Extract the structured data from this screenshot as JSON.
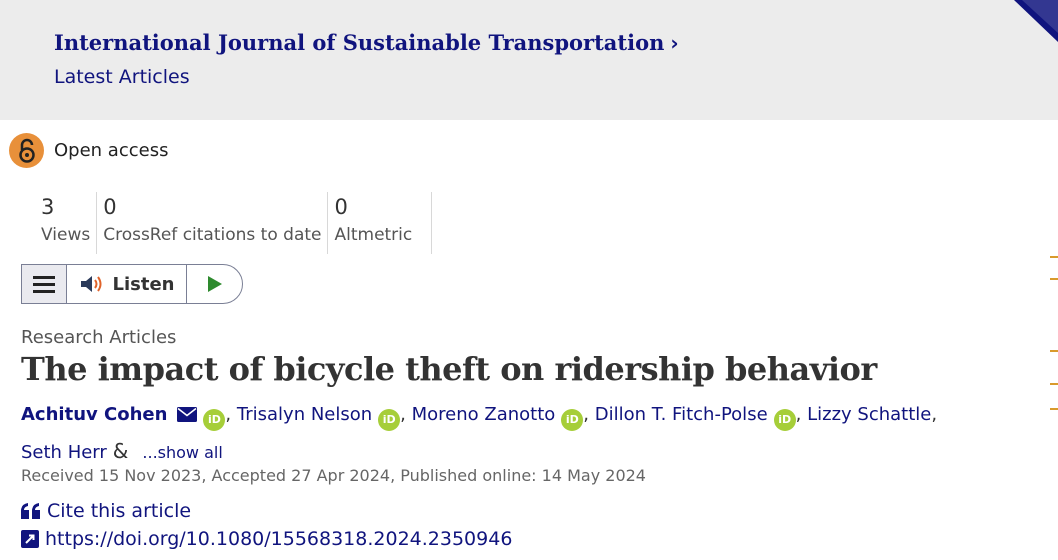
{
  "header": {
    "journal_title": "International Journal of Sustainable Transportation",
    "journal_chevron": "›",
    "latest_articles": "Latest Articles"
  },
  "access": {
    "label": "Open access"
  },
  "metrics": [
    {
      "value": "3",
      "label": "Views"
    },
    {
      "value": "0",
      "label": "CrossRef citations to date"
    },
    {
      "value": "0",
      "label": "Altmetric"
    }
  ],
  "toolbar": {
    "listen_label": "Listen"
  },
  "article": {
    "type": "Research Articles",
    "title": "The impact of bicycle theft on ridership behavior",
    "authors": [
      "Achituv Cohen",
      "Trisalyn Nelson",
      "Moreno Zanotto",
      "Dillon T. Fitch-Polse",
      "Lizzy Schattle",
      "Seth Herr"
    ],
    "orcid_label": "iD",
    "ampersand": "&",
    "show_all": "...show all",
    "dates": "Received 15 Nov 2023, Accepted 27 Apr 2024, Published online: 14 May 2024",
    "cite_label": "Cite this article",
    "doi": "https://doi.org/10.1080/15568318.2024.2350946"
  },
  "colors": {
    "link_navy": "#10147e",
    "open_access_orange": "#e8903a",
    "orcid_green": "#a6ce39",
    "header_gray": "#ececec"
  },
  "icons": [
    "open-access-lock-icon",
    "menu-icon",
    "speaker-icon",
    "play-icon",
    "mail-icon",
    "orcid-icon",
    "quote-icon",
    "external-link-icon",
    "chevron-right-icon"
  ]
}
